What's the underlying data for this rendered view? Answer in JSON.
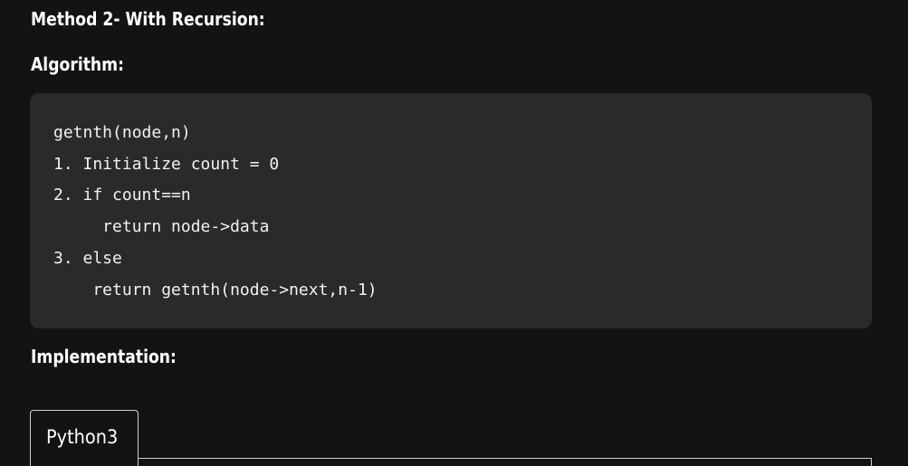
{
  "headings": {
    "method": "Method 2- With Recursion:",
    "algorithm": "Algorithm:",
    "implementation": "Implementation:"
  },
  "code": {
    "lines": [
      "getnth(node,n)",
      "1. Initialize count = 0",
      "2. if count==n",
      "     return node->data",
      "3. else",
      "    return getnth(node->next,n-1)"
    ]
  },
  "tabs": [
    {
      "label": "Python3",
      "active": true
    }
  ],
  "colors": {
    "page_background": "#131313",
    "code_background": "#2a2a2c",
    "text": "#ffffff",
    "tab_border": "#cfcfcf"
  }
}
